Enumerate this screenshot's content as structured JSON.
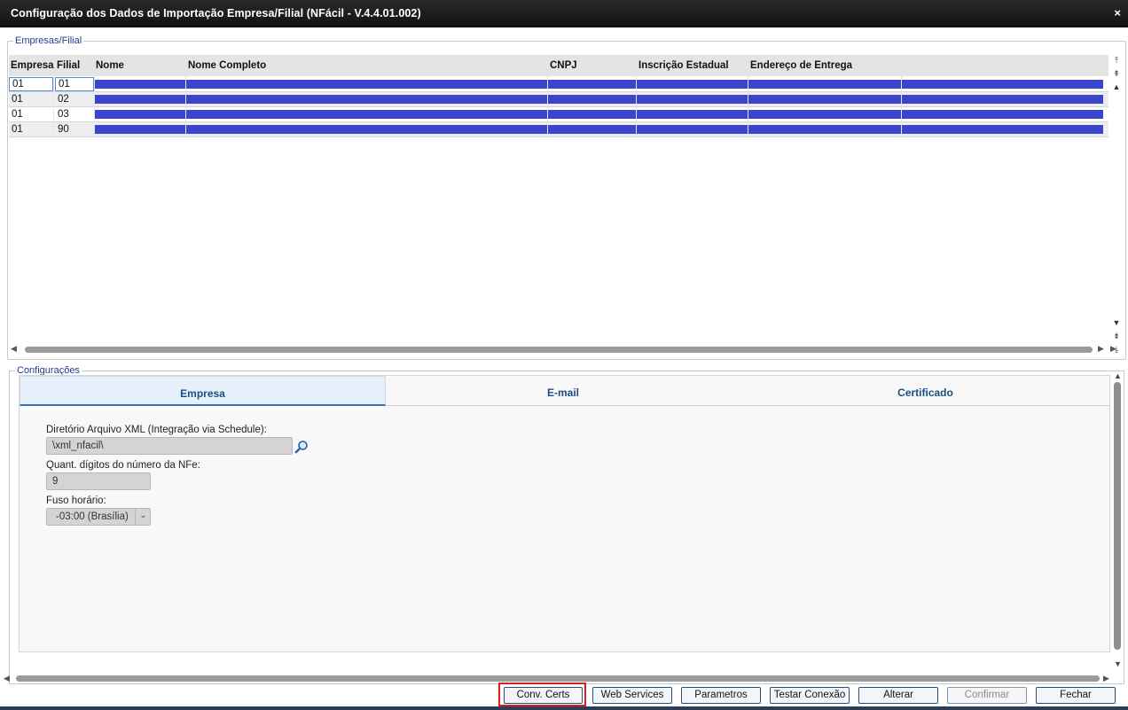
{
  "window": {
    "title": "Configuração dos Dados de Importação Empresa/Filial (NFácil - V.4.4.01.002)",
    "close_label": "×"
  },
  "group1": {
    "legend": "Empresas/Filial"
  },
  "grid": {
    "columns": [
      "Empresa",
      "Filial",
      "Nome",
      "Nome Completo",
      "CNPJ",
      "Inscrição Estadual",
      "Endereço de Entrega"
    ],
    "rows": [
      {
        "empresa": "01",
        "filial": "01"
      },
      {
        "empresa": "01",
        "filial": "02"
      },
      {
        "empresa": "01",
        "filial": "03"
      },
      {
        "empresa": "01",
        "filial": "90"
      }
    ]
  },
  "group2": {
    "legend": "Configurações"
  },
  "tabs": [
    {
      "label": "Empresa",
      "active": true
    },
    {
      "label": "E-mail",
      "active": false
    },
    {
      "label": "Certificado",
      "active": false
    }
  ],
  "form": {
    "xml_dir_label": "Diretório Arquivo XML (Integração via Schedule):",
    "xml_dir_value": "\\xml_nfacil\\",
    "digits_label": "Quant. dígitos do número da NFe:",
    "digits_value": "9",
    "tz_label": "Fuso horário:",
    "tz_value": "-03:00 (Brasília)"
  },
  "buttons": {
    "conv_certs": "Conv. Certs",
    "web_services": "Web Services",
    "parametros": "Parametros",
    "testar_conexao": "Testar Conexão",
    "alterar": "Alterar",
    "confirmar": "Confirmar",
    "fechar": "Fechar"
  },
  "colors": {
    "row_bar": "#3a45cc",
    "highlight": "#e31b1b",
    "title_bg": "#111111"
  },
  "icons": {
    "search": "magnifier-icon",
    "close": "close-icon"
  }
}
